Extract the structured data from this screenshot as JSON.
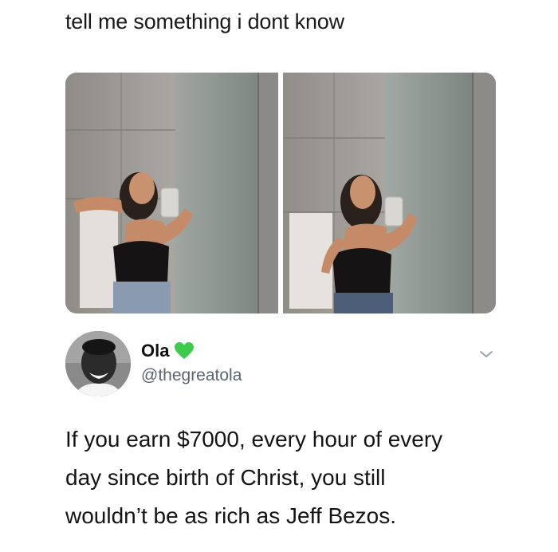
{
  "meme": {
    "caption": "tell me something i dont know"
  },
  "photos": [
    {
      "name": "mirror-selfie-1"
    },
    {
      "name": "mirror-selfie-2"
    }
  ],
  "tweet": {
    "display_name": "Ola",
    "verified_icon": "green-heart-icon",
    "handle": "@thegreatola",
    "more_icon": "chevron-down-icon",
    "text_lines": [
      "If you earn $7000, every hour of every",
      "day since birth of Christ, you still",
      "wouldn’t be as rich as Jeff Bezos."
    ]
  },
  "colors": {
    "heart": "#3ccb4a",
    "handle": "#5b6570",
    "chevron": "#9aa4ad"
  }
}
